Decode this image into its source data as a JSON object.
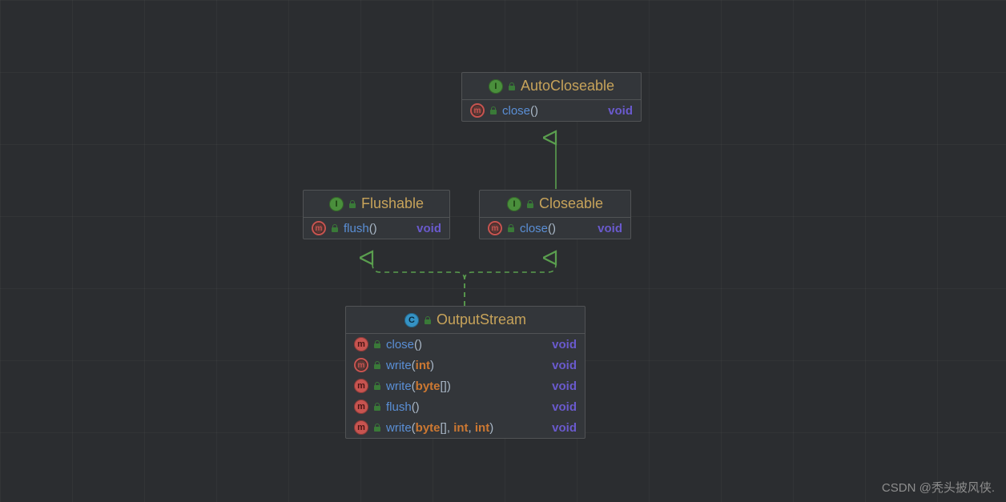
{
  "chart_data": {
    "type": "diagram",
    "title": "Java OutputStream class hierarchy (UML)",
    "nodes": [
      {
        "id": "AutoCloseable",
        "kind": "interface",
        "members": [
          {
            "name": "close",
            "params": "",
            "return": "void",
            "abstract": true
          }
        ]
      },
      {
        "id": "Flushable",
        "kind": "interface",
        "members": [
          {
            "name": "flush",
            "params": "",
            "return": "void",
            "abstract": true
          }
        ]
      },
      {
        "id": "Closeable",
        "kind": "interface",
        "members": [
          {
            "name": "close",
            "params": "",
            "return": "void",
            "abstract": true
          }
        ]
      },
      {
        "id": "OutputStream",
        "kind": "abstract class",
        "members": [
          {
            "name": "close",
            "params": "",
            "return": "void",
            "abstract": false
          },
          {
            "name": "write",
            "params": "int",
            "return": "void",
            "abstract": true
          },
          {
            "name": "write",
            "params": "byte[]",
            "return": "void",
            "abstract": false
          },
          {
            "name": "flush",
            "params": "",
            "return": "void",
            "abstract": false
          },
          {
            "name": "write",
            "params": "byte[], int, int",
            "return": "void",
            "abstract": false
          }
        ]
      }
    ],
    "edges": [
      {
        "from": "Closeable",
        "to": "AutoCloseable",
        "relation": "extends",
        "style": "solid"
      },
      {
        "from": "OutputStream",
        "to": "Flushable",
        "relation": "implements",
        "style": "dashed"
      },
      {
        "from": "OutputStream",
        "to": "Closeable",
        "relation": "implements",
        "style": "dashed"
      }
    ]
  },
  "labels": {
    "autoCloseable": "AutoCloseable",
    "flushable": "Flushable",
    "closeable": "Closeable",
    "outputStream": "OutputStream",
    "void": "void",
    "close": "close",
    "flush": "flush",
    "write": "write",
    "int": "int",
    "byteArr": "byte",
    "I": "I",
    "C": "C",
    "m": "m"
  },
  "watermark": "CSDN @秃头披风侠."
}
